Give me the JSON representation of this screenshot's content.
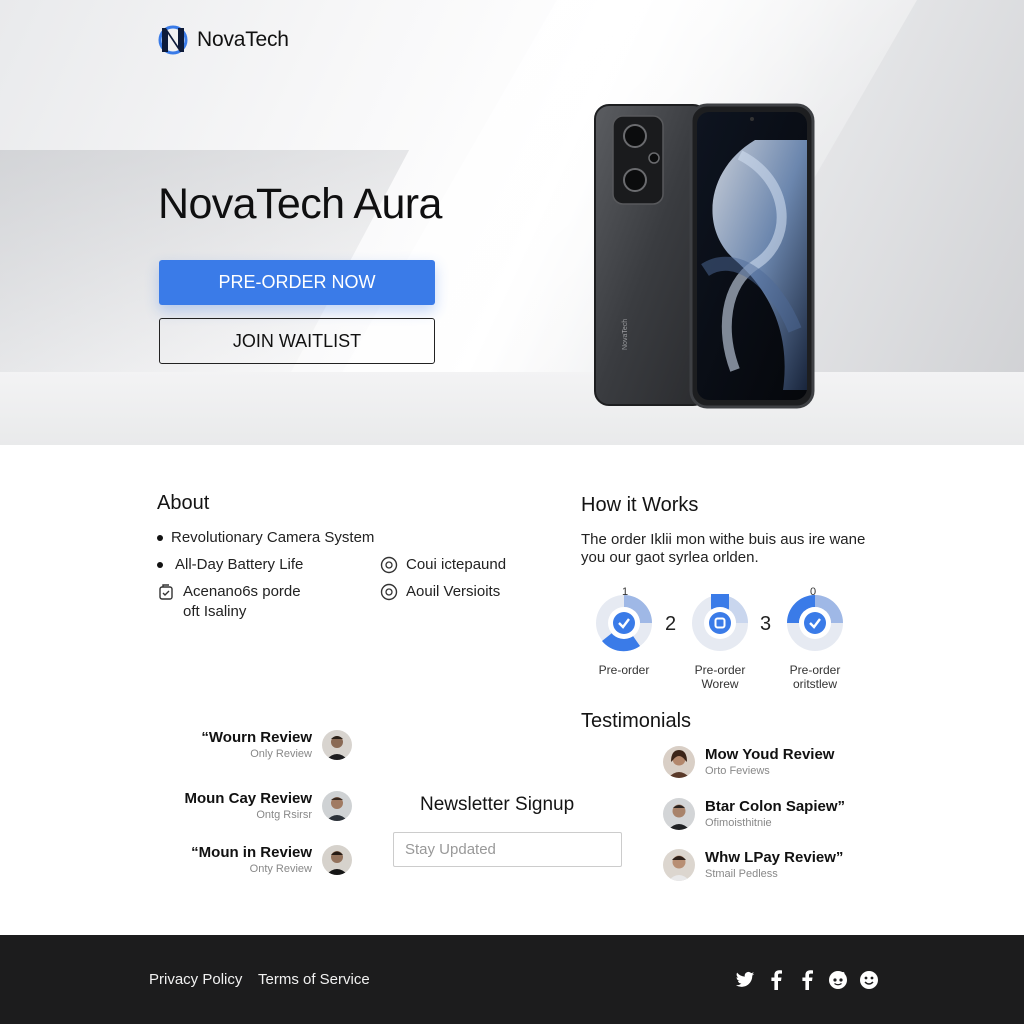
{
  "brand": {
    "name": "NovaTech"
  },
  "hero": {
    "title": "NovaTech Aura",
    "primary_cta": "PRE-ORDER NOW",
    "secondary_cta": "JOIN WAITLIST",
    "accent_color": "#3a7be8"
  },
  "about": {
    "title": "About",
    "features": [
      {
        "label": "Revolutionary Camera System",
        "icon": "bullet"
      },
      {
        "label": "All-Day Battery Life",
        "icon": "bullet"
      },
      {
        "label": "Acenano6s porde\noft Isaliny",
        "icon": "box-icon"
      },
      {
        "label": "Coui ictepaund",
        "icon": "circle-icon"
      },
      {
        "label": "Aouil Versioits",
        "icon": "circle-icon"
      }
    ]
  },
  "how": {
    "title": "How it Works",
    "text": "The order Iklii mon withe buis aus ire wane you our gaot syrlea orlden.",
    "steps": [
      {
        "top": "1",
        "label": "Pre-order",
        "label2": ""
      },
      {
        "number": "2",
        "label": "Pre-order",
        "label2": "Worew"
      },
      {
        "number": "3",
        "top": "0",
        "label": "Pre-order",
        "label2": "oritstlew"
      }
    ]
  },
  "reviews": [
    {
      "name": "“Wourn Review",
      "sub": "Only Review"
    },
    {
      "name": "Moun Cay Review",
      "sub": "Ontg Rsirsr"
    },
    {
      "name": "“Moun in Review",
      "sub": "Onty Review"
    }
  ],
  "newsletter": {
    "title": "Newsletter Signup",
    "placeholder": "Stay Updated"
  },
  "testimonials": {
    "title": "Testimonials",
    "items": [
      {
        "name": "Mow Youd Review",
        "sub": "Orto Feviews"
      },
      {
        "name": "Btar Colon Sapiew”",
        "sub": "Ofimoisthitnie"
      },
      {
        "name": "Whw LPay Review”",
        "sub": "Stmail Pedless"
      }
    ]
  },
  "footer": {
    "links": [
      "Privacy Policy",
      "Terms of Service"
    ],
    "social_icons": [
      "twitter-icon",
      "facebook-icon",
      "facebook-icon",
      "reddit-icon",
      "smile-icon"
    ]
  }
}
